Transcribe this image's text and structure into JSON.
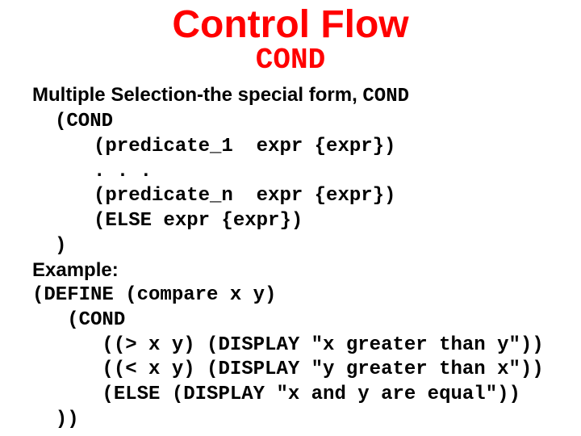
{
  "title": "Control Flow",
  "subtitle": "COND",
  "lead_plain": "Multiple Selection-the special form, ",
  "lead_mono": "COND",
  "syntax": {
    "open": "(COND",
    "l1": "(predicate_1  expr {expr})",
    "l2": ". . .",
    "l3": "(predicate_n  expr {expr})",
    "l4": "(ELSE expr {expr})",
    "close": ")"
  },
  "example_label": "Example:",
  "example": {
    "l1": "(DEFINE (compare x y)",
    "l2": "   (COND",
    "l3": "      ((> x y) (DISPLAY \"x greater than y\"))",
    "l4": "      ((< x y) (DISPLAY \"y greater than x\"))",
    "l5": "      (ELSE (DISPLAY \"x and y are equal\"))",
    "l6": "  ))"
  }
}
